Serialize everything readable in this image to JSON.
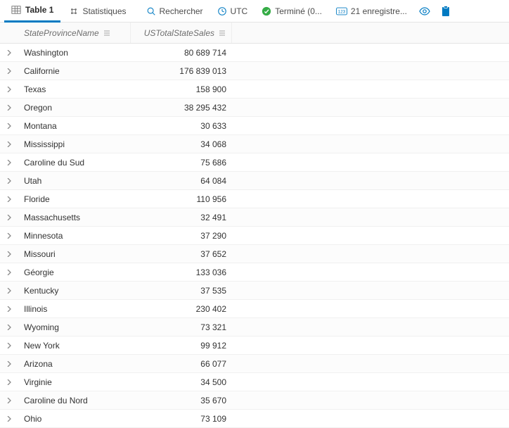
{
  "toolbar": {
    "table_tab": "Table 1",
    "stats": "Statistiques",
    "search": "Rechercher",
    "time": "UTC",
    "status": "Terminé (0...",
    "records": "21 enregistre..."
  },
  "columns": {
    "state": "StateProvinceName",
    "sales": "USTotalStateSales"
  },
  "rows": [
    {
      "state": "Washington",
      "sales": "80 689 714"
    },
    {
      "state": "Californie",
      "sales": "176 839 013"
    },
    {
      "state": "Texas",
      "sales": "158 900"
    },
    {
      "state": "Oregon",
      "sales": "38 295 432"
    },
    {
      "state": "Montana",
      "sales": "30 633"
    },
    {
      "state": "Mississippi",
      "sales": "34 068"
    },
    {
      "state": "Caroline du Sud",
      "sales": "75 686"
    },
    {
      "state": "Utah",
      "sales": "64 084"
    },
    {
      "state": "Floride",
      "sales": "110 956"
    },
    {
      "state": "Massachusetts",
      "sales": "32 491"
    },
    {
      "state": "Minnesota",
      "sales": "37 290"
    },
    {
      "state": "Missouri",
      "sales": "37 652"
    },
    {
      "state": "Géorgie",
      "sales": "133 036"
    },
    {
      "state": "Kentucky",
      "sales": "37 535"
    },
    {
      "state": "Illinois",
      "sales": "230 402"
    },
    {
      "state": "Wyoming",
      "sales": "73 321"
    },
    {
      "state": "New York",
      "sales": "99 912"
    },
    {
      "state": "Arizona",
      "sales": "66 077"
    },
    {
      "state": "Virginie",
      "sales": "34 500"
    },
    {
      "state": "Caroline du Nord",
      "sales": "35 670"
    },
    {
      "state": "Ohio",
      "sales": "73 109"
    }
  ]
}
